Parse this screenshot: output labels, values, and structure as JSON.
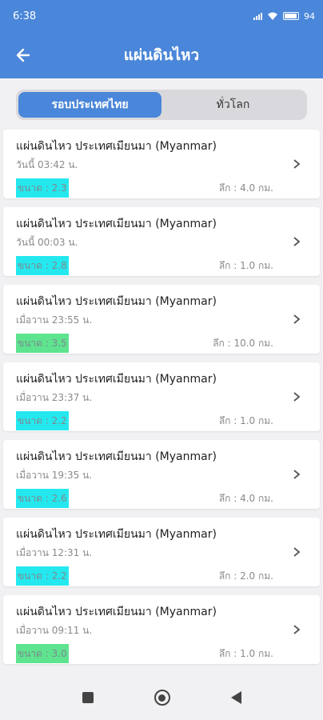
{
  "status_bar": {
    "time": "6:38",
    "battery": "94"
  },
  "app_bar": {
    "title": "แผ่นดินไหว"
  },
  "tabs": [
    {
      "label": "รอบประเทศไทย",
      "active": true
    },
    {
      "label": "ทั่วโลก",
      "active": false
    }
  ],
  "quakes": [
    {
      "title": "แผ่นดินไหว ประเทศเมียนมา (Myanmar)",
      "time": "วันนี้ 03:42 น.",
      "magnitude": "ขนาด : 2.3",
      "depth": "ลึก : 4.0 กม.",
      "color": "#25e8ef"
    },
    {
      "title": "แผ่นดินไหว ประเทศเมียนมา (Myanmar)",
      "time": "วันนี้ 00:03 น.",
      "magnitude": "ขนาด : 2.8",
      "depth": "ลึก : 1.0 กม.",
      "color": "#25e8ef"
    },
    {
      "title": "แผ่นดินไหว ประเทศเมียนมา (Myanmar)",
      "time": "เมื่อวาน 23:55 น.",
      "magnitude": "ขนาด : 3.5",
      "depth": "ลึก : 10.0 กม.",
      "color": "#5ee38f"
    },
    {
      "title": "แผ่นดินไหว ประเทศเมียนมา (Myanmar)",
      "time": "เมื่อวาน 23:37 น.",
      "magnitude": "ขนาด : 2.2",
      "depth": "ลึก : 1.0 กม.",
      "color": "#25e8ef"
    },
    {
      "title": "แผ่นดินไหว ประเทศเมียนมา (Myanmar)",
      "time": "เมื่อวาน 19:35 น.",
      "magnitude": "ขนาด : 2.6",
      "depth": "ลึก : 4.0 กม.",
      "color": "#25e8ef"
    },
    {
      "title": "แผ่นดินไหว ประเทศเมียนมา (Myanmar)",
      "time": "เมื่อวาน 12:31 น.",
      "magnitude": "ขนาด : 2.2",
      "depth": "ลึก : 2.0 กม.",
      "color": "#25e8ef"
    },
    {
      "title": "แผ่นดินไหว ประเทศเมียนมา (Myanmar)",
      "time": "เมื่อวาน 09:11 น.",
      "magnitude": "ขนาด : 3.0",
      "depth": "ลึก : 1.0 กม.",
      "color": "#5ee38f"
    }
  ],
  "colors": {
    "primary": "#4a86d9",
    "background": "#f1f1f3"
  },
  "icons": {
    "back": "arrow-left-icon",
    "row": "chevron-right-icon"
  }
}
